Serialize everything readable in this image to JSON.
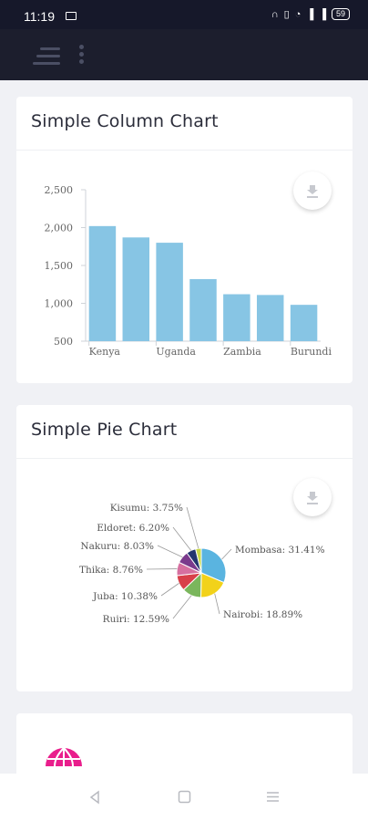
{
  "status_bar": {
    "time": "11:19",
    "battery": "59",
    "icons": [
      "headphones-icon",
      "vibrate-icon",
      "wifi-icon",
      "signal-icon",
      "signal-icon"
    ]
  },
  "header": {
    "icons": [
      "menu-icon",
      "more-vert-icon"
    ]
  },
  "column_card": {
    "title": "Simple Column Chart",
    "download_icon": "download-icon"
  },
  "pie_card": {
    "title": "Simple Pie Chart",
    "download_icon": "download-icon"
  },
  "third_card": {
    "icon": "globe-icon",
    "icon_color": "#e91e8c"
  },
  "nav_bar": {
    "icons": [
      "back-icon",
      "home-icon",
      "recents-icon"
    ]
  },
  "chart_data": [
    {
      "type": "bar",
      "categories": [
        "Kenya",
        "",
        "Uganda",
        "",
        "Zambia",
        "",
        "Burundi"
      ],
      "values": [
        2020,
        1870,
        1800,
        1320,
        1120,
        1110,
        980
      ],
      "ylim": [
        500,
        2500
      ],
      "yticks": [
        "2,500",
        "2,000",
        "1,500",
        "1,000",
        "500"
      ],
      "ytick_values": [
        2500,
        2000,
        1500,
        1000,
        500
      ],
      "color": "#87c5e4"
    },
    {
      "type": "pie",
      "slices": [
        {
          "label": "Mombasa: 31.41%",
          "value": 31.41,
          "color": "#5ab4e0"
        },
        {
          "label": "Nairobi: 18.89%",
          "value": 18.89,
          "color": "#f2d21a"
        },
        {
          "label": "Ruiri: 12.59%",
          "value": 12.59,
          "color": "#7ab65c"
        },
        {
          "label": "Juba: 10.38%",
          "value": 10.38,
          "color": "#d8404a"
        },
        {
          "label": "Thika: 8.76%",
          "value": 8.76,
          "color": "#d670a0"
        },
        {
          "label": "Nakuru: 8.03%",
          "value": 8.03,
          "color": "#7a3a8c"
        },
        {
          "label": "Eldoret: 6.20%",
          "value": 6.2,
          "color": "#22366e"
        },
        {
          "label": "Kisumu: 3.75%",
          "value": 3.75,
          "color": "#c9d84a"
        }
      ]
    }
  ]
}
